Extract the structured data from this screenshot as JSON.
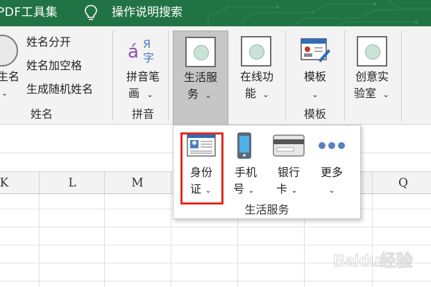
{
  "titlebar": {
    "tab_label": "PDF工具集",
    "search_label": "操作说明搜索",
    "bulb_icon": "lightbulb-icon",
    "bg_color": "#217346"
  },
  "ribbon": {
    "name_group": {
      "partial_button_label_1": "生名",
      "partial_chevron": "⌄",
      "cmd_split_name": "姓名分开",
      "cmd_add_space": "姓名加空格",
      "cmd_random_name": "生成随机姓名",
      "group_label": "姓名"
    },
    "pinyin_group": {
      "button_label_line1": "拼音笔",
      "button_label_line2": "画",
      "chevron": "⌄",
      "group_label": "拼音",
      "icon_glyph_a": "á",
      "icon_glyph_ya": "Я",
      "icon_glyph_zi": "字"
    },
    "life_service": {
      "label_line1": "生活服",
      "label_line2": "务",
      "chevron": "⌄"
    },
    "online_function": {
      "label_line1": "在线功",
      "label_line2": "能",
      "chevron": "⌄"
    },
    "template_group": {
      "button_label": "模板",
      "chevron": "⌄",
      "group_label": "模板"
    },
    "creative_lab": {
      "label_line1": "创意实",
      "label_line2": "验室",
      "chevron": "⌄"
    }
  },
  "dropdown": {
    "items": [
      {
        "label_line1": "身份",
        "label_line2": "证",
        "chevron": "⌄",
        "icon": "id-card-icon",
        "highlighted": true
      },
      {
        "label_line1": "手机",
        "label_line2": "号",
        "chevron": "⌄",
        "icon": "mobile-phone-icon"
      },
      {
        "label_line1": "银行",
        "label_line2": "卡",
        "chevron": "⌄",
        "icon": "bank-card-icon"
      },
      {
        "label_line1": "更多",
        "label_line2": "",
        "chevron": "⌄",
        "icon": "more-dots-icon"
      }
    ],
    "footer_label": "生活服务",
    "highlight_color": "#e0291d"
  },
  "sheet": {
    "columns": [
      "K",
      "L",
      "M",
      "Q"
    ]
  },
  "watermark": {
    "text": "Baidu经验"
  }
}
